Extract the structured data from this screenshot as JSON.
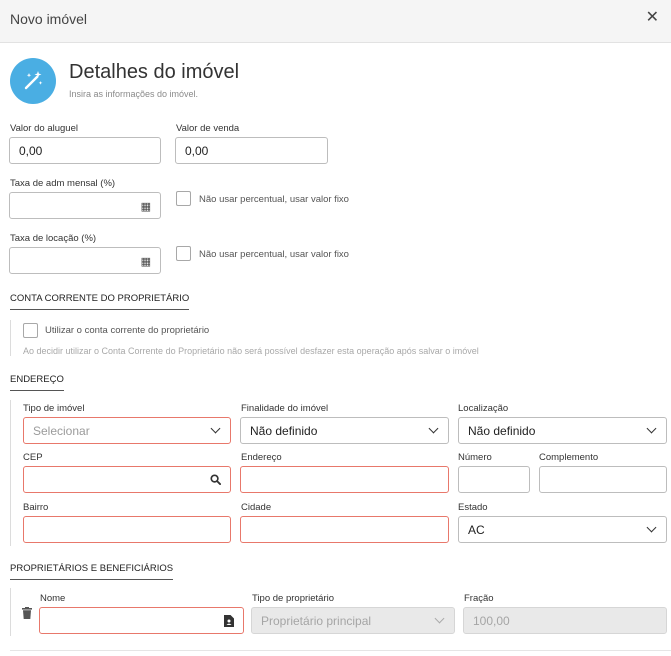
{
  "dialog": {
    "title": "Novo imóvel",
    "close_symbol": "✕"
  },
  "hero": {
    "icon": "magic-wand-icon",
    "title": "Detalhes do imóvel",
    "subtitle": "Insira as informações do imóvel.",
    "icon_color": "#4aaee3"
  },
  "fields": {
    "rent": {
      "label": "Valor do aluguel",
      "value": "0,00"
    },
    "sale": {
      "label": "Valor de venda",
      "value": "0,00"
    },
    "adm_fee": {
      "label": "Taxa de adm mensal (%)",
      "value": "",
      "checkbox_label": "Não usar percentual, usar valor fixo"
    },
    "lease_fee": {
      "label": "Taxa de locação (%)",
      "value": "",
      "checkbox_label": "Não usar percentual, usar valor fixo"
    }
  },
  "owner_account": {
    "heading": "CONTA CORRENTE DO PROPRIETÁRIO",
    "checkbox_label": "Utilizar o conta corrente do proprietário",
    "note": "Ao decidir utilizar o Conta Corrente do Proprietário não será possível desfazer esta operação após salvar o imóvel"
  },
  "address": {
    "heading": "ENDEREÇO",
    "property_type": {
      "label": "Tipo de imóvel",
      "placeholder": "Selecionar"
    },
    "purpose": {
      "label": "Finalidade do imóvel",
      "value": "Não definido"
    },
    "location": {
      "label": "Localização",
      "value": "Não definido"
    },
    "zip": {
      "label": "CEP",
      "value": ""
    },
    "street": {
      "label": "Endereço",
      "value": ""
    },
    "number": {
      "label": "Número",
      "value": ""
    },
    "complement": {
      "label": "Complemento",
      "value": ""
    },
    "district": {
      "label": "Bairro",
      "value": ""
    },
    "city": {
      "label": "Cidade",
      "value": ""
    },
    "state": {
      "label": "Estado",
      "value": "AC"
    }
  },
  "owners": {
    "heading": "PROPRIETÁRIOS E BENEFICIÁRIOS",
    "name": {
      "label": "Nome",
      "value": ""
    },
    "owner_type": {
      "label": "Tipo de proprietário",
      "value": "Proprietário principal"
    },
    "fraction": {
      "label": "Fração",
      "value": "100,00"
    }
  },
  "colors": {
    "required_border": "#e8786b",
    "disabled_bg": "#e9e9e9"
  }
}
